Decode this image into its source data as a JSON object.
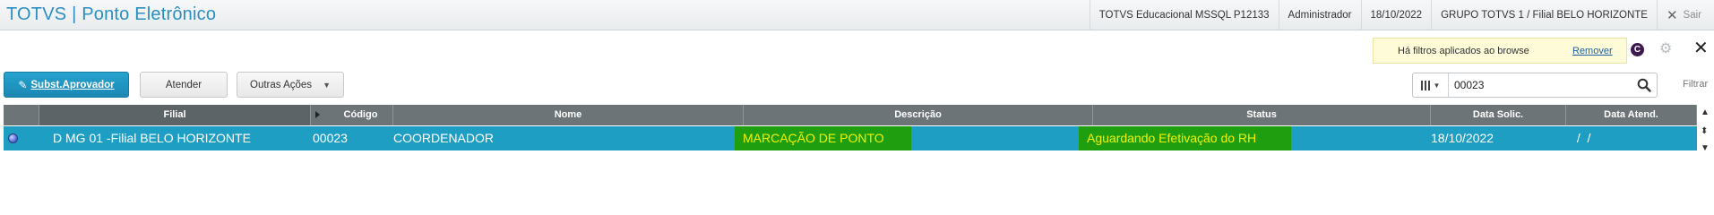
{
  "app": {
    "title": "TOTVS | Ponto Eletrônico"
  },
  "topbar": {
    "environment": "TOTVS Educacional MSSQL P12133",
    "user": "Administrador",
    "date": "18/10/2022",
    "company": "GRUPO TOTVS 1 / Filial BELO HORIZONTE",
    "exit_label": "Sair"
  },
  "filter_notice": {
    "message": "Há filtros aplicados ao browse",
    "remove_label": "Remover"
  },
  "toolbar": {
    "primary_label": "Subst.Aprovador",
    "atender_label": "Atender",
    "outras_label": "Outras Ações"
  },
  "search": {
    "value": "00023",
    "filter_label": "Filtrar"
  },
  "grid": {
    "columns": [
      "Filial",
      "Código",
      "Nome",
      "Descrição",
      "Status",
      "Data Solic.",
      "Data Atend."
    ],
    "rows": [
      {
        "filial": "D MG 01 -Filial BELO HORIZONTE",
        "codigo": "00023",
        "nome": "COORDENADOR",
        "descricao": "MARCAÇÃO DE PONTO",
        "status": "Aguardando Efetivação do RH",
        "data_solic": "18/10/2022",
        "data_atend": " /  /"
      }
    ]
  },
  "colors": {
    "brand": "#2b8fc0",
    "header": "#6c7478",
    "selected_row": "#1f9ec4",
    "highlight_cell": "#1f9e0f",
    "highlight_text": "#f2f200",
    "primary_button": "#1b87b3"
  },
  "icons": [
    "close-icon",
    "pencil-icon",
    "chevron-down-icon",
    "columns-icon",
    "search-icon",
    "circle-c-icon",
    "gear-icon",
    "sort-arrow-icon",
    "legend-dot-icon"
  ]
}
